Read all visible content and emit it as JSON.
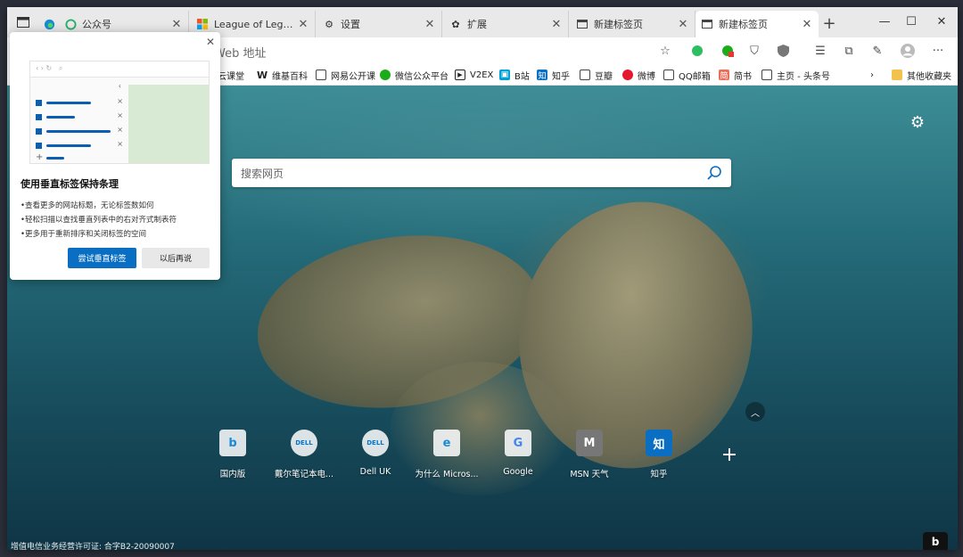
{
  "tabs": [
    {
      "label": "公众号",
      "icon": "wechat-icon"
    },
    {
      "label": "League of Legends New",
      "icon": "microsoft-icon"
    },
    {
      "label": "设置",
      "icon": "gear-icon"
    },
    {
      "label": "扩展",
      "icon": "puzzle-icon"
    },
    {
      "label": "新建标签页",
      "icon": "newtab-icon"
    },
    {
      "label": "新建标签页",
      "icon": "newtab-icon",
      "active": true
    }
  ],
  "toolbar": {
    "address_placeholder": "Web 地址"
  },
  "bookmarks": [
    {
      "label": "云课堂"
    },
    {
      "label": "维基百科",
      "icon_text": "W"
    },
    {
      "label": "网易公开课"
    },
    {
      "label": "微信公众平台"
    },
    {
      "label": "V2EX"
    },
    {
      "label": "B站"
    },
    {
      "label": "知乎",
      "icon_text": "知"
    },
    {
      "label": "豆瓣"
    },
    {
      "label": "微博"
    },
    {
      "label": "QQ邮箱"
    },
    {
      "label": "简书"
    },
    {
      "label": "主页 - 头条号"
    }
  ],
  "other_bookmarks": "其他收藏夹",
  "search": {
    "placeholder": "搜索网页"
  },
  "tiles": [
    {
      "label": "国内版",
      "glyph": "b"
    },
    {
      "label": "戴尔笔记本电...",
      "glyph": "DELL"
    },
    {
      "label": "Dell UK",
      "glyph": "DELL"
    },
    {
      "label": "为什么 Micros...",
      "glyph": "e"
    },
    {
      "label": "Google",
      "glyph": "G"
    },
    {
      "label": "MSN 天气",
      "glyph": "M"
    },
    {
      "label": "知乎",
      "glyph": "知"
    }
  ],
  "footer": {
    "license": "增值电信业务经营许可证: 合字B2-20090007",
    "bing_glyph": "b"
  },
  "popup": {
    "title": "使用垂直标签保持条理",
    "bullets": [
      "•查看更多的网站标题，无论标签数如何",
      "•轻松扫描以查找垂直列表中的右对齐式制表符",
      "•更多用于重新排序和关闭标签的空间"
    ],
    "try_button": "尝试垂直标签",
    "later_button": "以后再说"
  },
  "colors": {
    "accent": "#0a6fc2",
    "tabstrip": "#e9e9e9"
  }
}
